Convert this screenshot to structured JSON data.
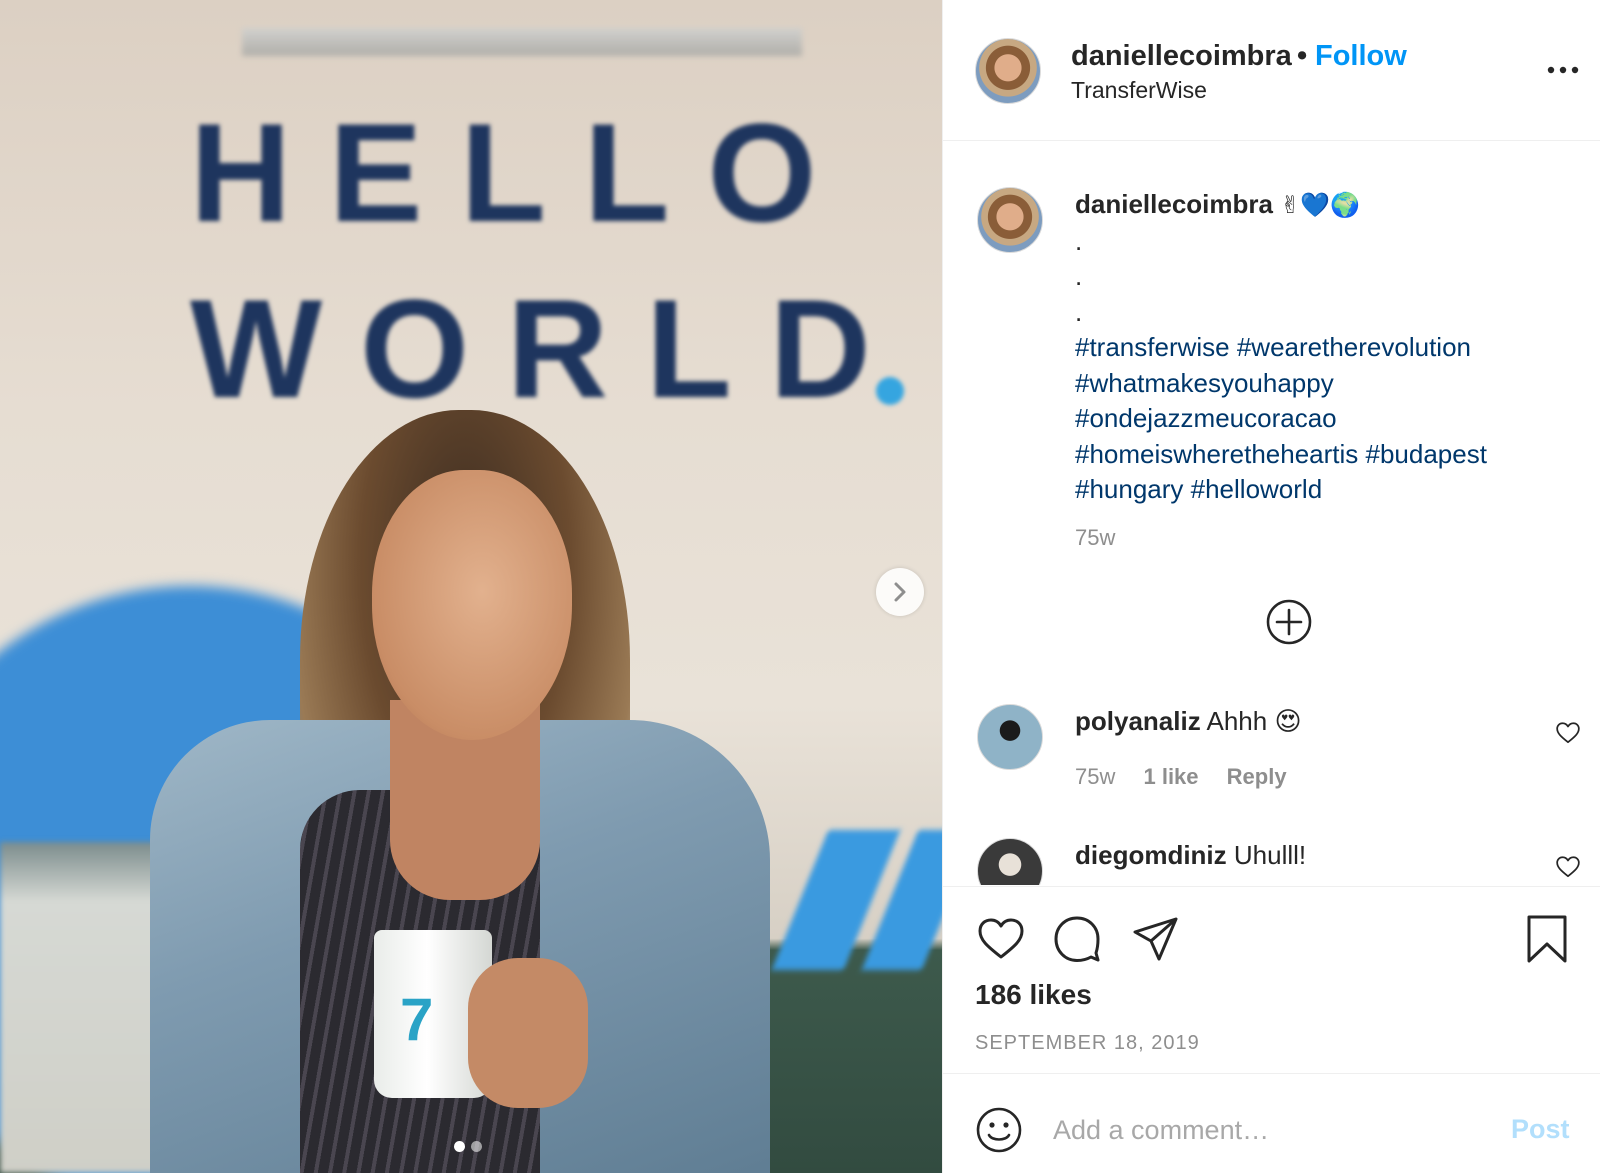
{
  "photo": {
    "wall_line1": "HELLO",
    "wall_line2": "WORLD",
    "mug_logo": "7",
    "carousel_total": 2,
    "carousel_active": 1
  },
  "header": {
    "username": "daniellecoimbra",
    "separator": "•",
    "follow_label": "Follow",
    "location": "TransferWise"
  },
  "caption": {
    "username": "daniellecoimbra",
    "emojis": "✌💙🌍",
    "dot_lines": [
      ".",
      ".",
      "."
    ],
    "hashtags_lines": [
      "#transferwise #wearetherevolution",
      "#whatmakesyouhappy",
      "#ondejazzmeucoracao",
      "#homeiswheretheheartis #budapest",
      "#hungary #helloworld"
    ],
    "time": "75w"
  },
  "comments": [
    {
      "username": "polyanaliz",
      "text": "Ahhh",
      "emoji": "😍",
      "time": "75w",
      "likes": "1 like",
      "reply": "Reply"
    },
    {
      "username": "diegomdiniz",
      "text": "Uhulll!"
    }
  ],
  "stats": {
    "likes": "186 likes",
    "date": "SEPTEMBER 18, 2019"
  },
  "add_comment": {
    "placeholder": "Add a comment…",
    "post_label": "Post"
  },
  "colors": {
    "link": "#0095f6",
    "hashtag": "#00376b",
    "muted": "#8e8e8e",
    "post_disabled": "#b2dffc"
  }
}
